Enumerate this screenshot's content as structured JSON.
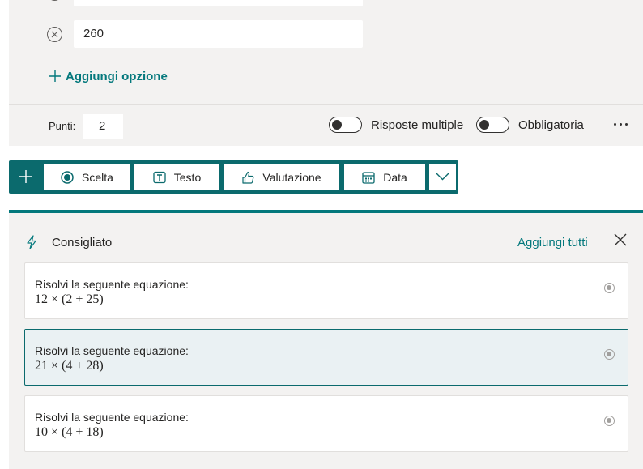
{
  "question": {
    "option_value": "260",
    "add_option_label": "Aggiungi opzione",
    "points_label": "Punti:",
    "points_value": "2",
    "multiple_answers_label": "Risposte multiple",
    "required_label": "Obbligatoria"
  },
  "toolbar": {
    "choice_label": "Scelta",
    "text_label": "Testo",
    "rating_label": "Valutazione",
    "date_label": "Data"
  },
  "suggestions": {
    "title": "Consigliato",
    "add_all_label": "Aggiungi tutti",
    "items": [
      {
        "line1": "Risolvi la seguente equazione:",
        "line2": "12 × (2 + 25)"
      },
      {
        "line1": "Risolvi la seguente equazione:",
        "line2": "21 × (4 + 28)"
      },
      {
        "line1": "Risolvi la seguente equazione:",
        "line2": "10 × (4 + 18)"
      }
    ]
  },
  "colors": {
    "accent": "#03787c",
    "toolbar": "#0b6a6d",
    "panel_bg": "#f3f2f1"
  }
}
